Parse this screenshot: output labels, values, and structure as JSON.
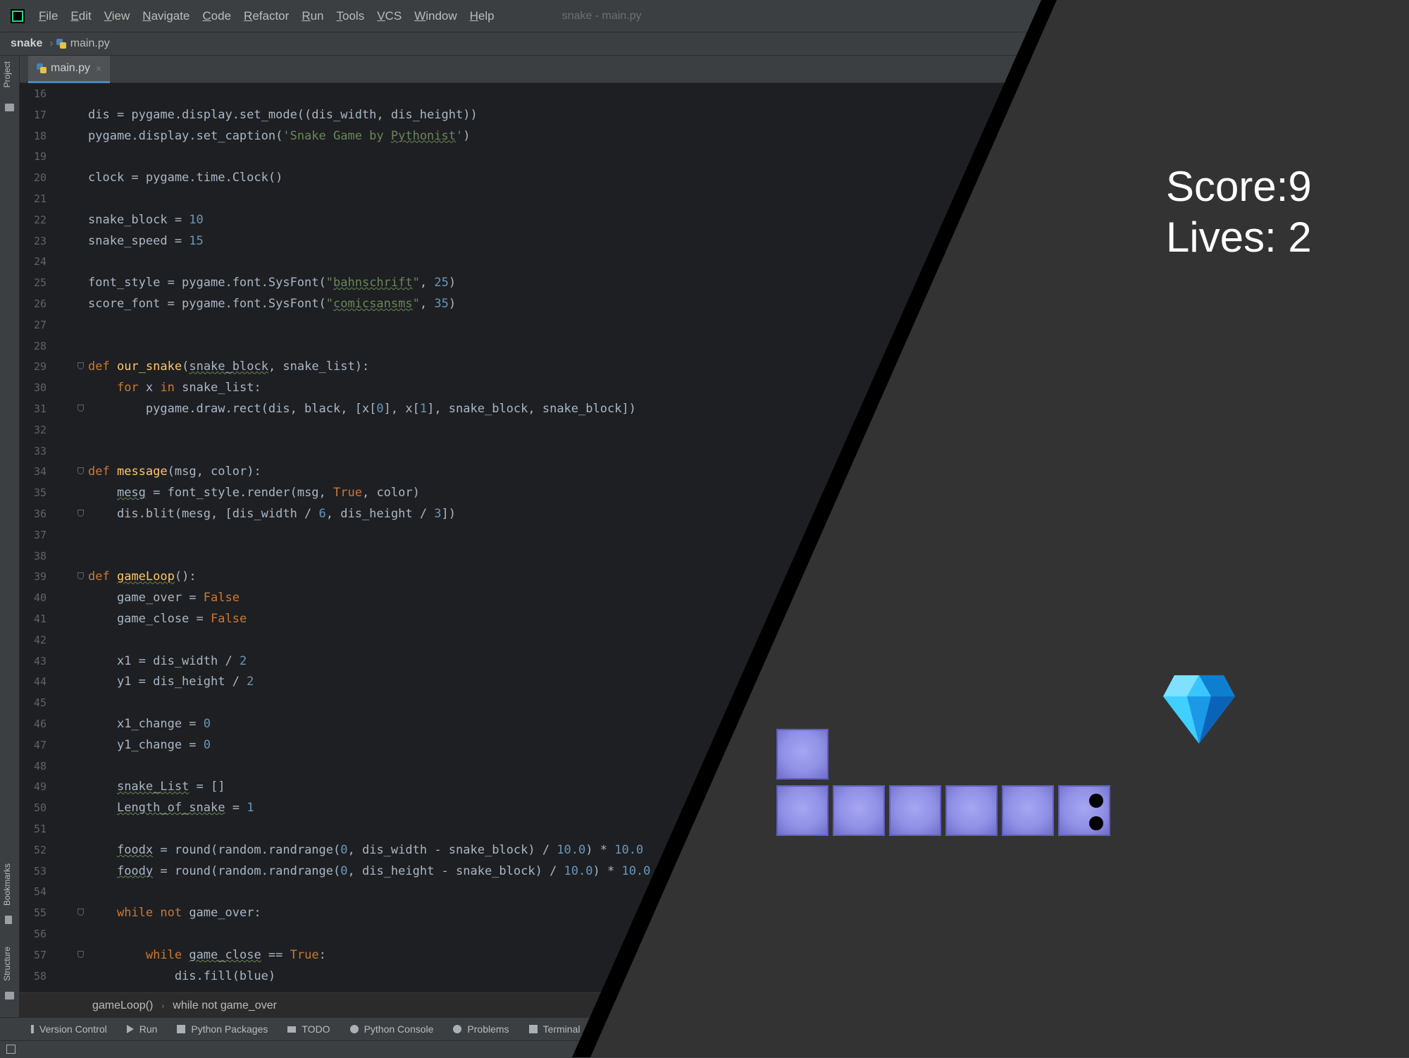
{
  "menubar": {
    "items": [
      "File",
      "Edit",
      "View",
      "Navigate",
      "Code",
      "Refactor",
      "Run",
      "Tools",
      "VCS",
      "Window",
      "Help"
    ],
    "window_title": "snake - main.py"
  },
  "navbar": {
    "project": "snake",
    "file": "main.py"
  },
  "tabs": [
    {
      "label": "main.py",
      "close": "×"
    }
  ],
  "left_strip": {
    "top": "Project",
    "bookmarks": "Bookmarks",
    "structure": "Structure"
  },
  "editor": {
    "lines": [
      {
        "n": "16",
        "html": ""
      },
      {
        "n": "17",
        "html": "dis = pygame.display.set_mode((dis_width, dis_height))"
      },
      {
        "n": "18",
        "html": "pygame.display.set_caption(<span class='s'>'Snake Game by <span class=\"u\">Pythonist</span>'</span>)"
      },
      {
        "n": "19",
        "html": ""
      },
      {
        "n": "20",
        "html": "clock = pygame.time.Clock()"
      },
      {
        "n": "21",
        "html": ""
      },
      {
        "n": "22",
        "html": "snake_block = <span class='n'>10</span>"
      },
      {
        "n": "23",
        "html": "snake_speed = <span class='n'>15</span>"
      },
      {
        "n": "24",
        "html": ""
      },
      {
        "n": "25",
        "html": "font_style = pygame.font.SysFont(<span class='s'>\"<span class='u'>bahnschrift</span>\"</span>, <span class='n'>25</span>)"
      },
      {
        "n": "26",
        "html": "score_font = pygame.font.SysFont(<span class='s'>\"<span class='u'>comicsansms</span>\"</span>, <span class='n'>35</span>)"
      },
      {
        "n": "27",
        "html": ""
      },
      {
        "n": "28",
        "html": ""
      },
      {
        "n": "29",
        "html": "<span class='k'>def</span> <span class='f'>our_snake</span>(<span class='u'>snake_block</span>, snake_list):",
        "fold": true
      },
      {
        "n": "30",
        "html": "    <span class='k'>for</span> x <span class='k'>in</span> snake_list:"
      },
      {
        "n": "31",
        "html": "        pygame.draw.rect(dis, black, [x[<span class='n'>0</span>], x[<span class='n'>1</span>], snake_block, snake_block])",
        "fold": true
      },
      {
        "n": "32",
        "html": ""
      },
      {
        "n": "33",
        "html": ""
      },
      {
        "n": "34",
        "html": "<span class='k'>def</span> <span class='f'>message</span>(msg, color):",
        "fold": true
      },
      {
        "n": "35",
        "html": "    <span class='u'>mesg</span> = font_style.render(msg, <span class='k'>True</span>, color)"
      },
      {
        "n": "36",
        "html": "    dis.blit(mesg, [dis_width / <span class='n'>6</span>, dis_height / <span class='n'>3</span>])",
        "fold": true
      },
      {
        "n": "37",
        "html": ""
      },
      {
        "n": "38",
        "html": ""
      },
      {
        "n": "39",
        "html": "<span class='k'>def</span> <span class='f u'>gameLoop</span>():",
        "fold": true
      },
      {
        "n": "40",
        "html": "    game_over = <span class='k'>False</span>"
      },
      {
        "n": "41",
        "html": "    game_close = <span class='k'>False</span>"
      },
      {
        "n": "42",
        "html": ""
      },
      {
        "n": "43",
        "html": "    x1 = dis_width / <span class='n'>2</span>"
      },
      {
        "n": "44",
        "html": "    y1 = dis_height / <span class='n'>2</span>"
      },
      {
        "n": "45",
        "html": ""
      },
      {
        "n": "46",
        "html": "    x1_change = <span class='n'>0</span>"
      },
      {
        "n": "47",
        "html": "    y1_change = <span class='n'>0</span>"
      },
      {
        "n": "48",
        "html": ""
      },
      {
        "n": "49",
        "html": "    <span class='u'>snake_List</span> = []"
      },
      {
        "n": "50",
        "html": "    <span class='u'>Length_of_snake</span> = <span class='n'>1</span>"
      },
      {
        "n": "51",
        "html": ""
      },
      {
        "n": "52",
        "html": "    <span class='u'>foodx</span> = round(random.randrange(<span class='n'>0</span>, dis_width - snake_block) / <span class='n'>10.0</span>) * <span class='n'>10.0</span>"
      },
      {
        "n": "53",
        "html": "    <span class='u'>foody</span> = round(random.randrange(<span class='n'>0</span>, dis_height - snake_block) / <span class='n'>10.0</span>) * <span class='n'>10.0</span>"
      },
      {
        "n": "54",
        "html": ""
      },
      {
        "n": "55",
        "html": "    <span class='k'>while not</span> game_over:",
        "fold": true
      },
      {
        "n": "56",
        "html": ""
      },
      {
        "n": "57",
        "html": "        <span class='k'>while</span> <span class='u'>game_close</span> == <span class='k'>True</span>:",
        "fold": true
      },
      {
        "n": "58",
        "html": "            dis.fill(blue)"
      }
    ]
  },
  "breadcrumbs": [
    "gameLoop()",
    "while not game_over"
  ],
  "toolwindows": [
    "Version Control",
    "Run",
    "Python Packages",
    "TODO",
    "Python Console",
    "Problems",
    "Terminal"
  ],
  "game": {
    "score": "Score:9",
    "lives": "Lives: 2"
  }
}
